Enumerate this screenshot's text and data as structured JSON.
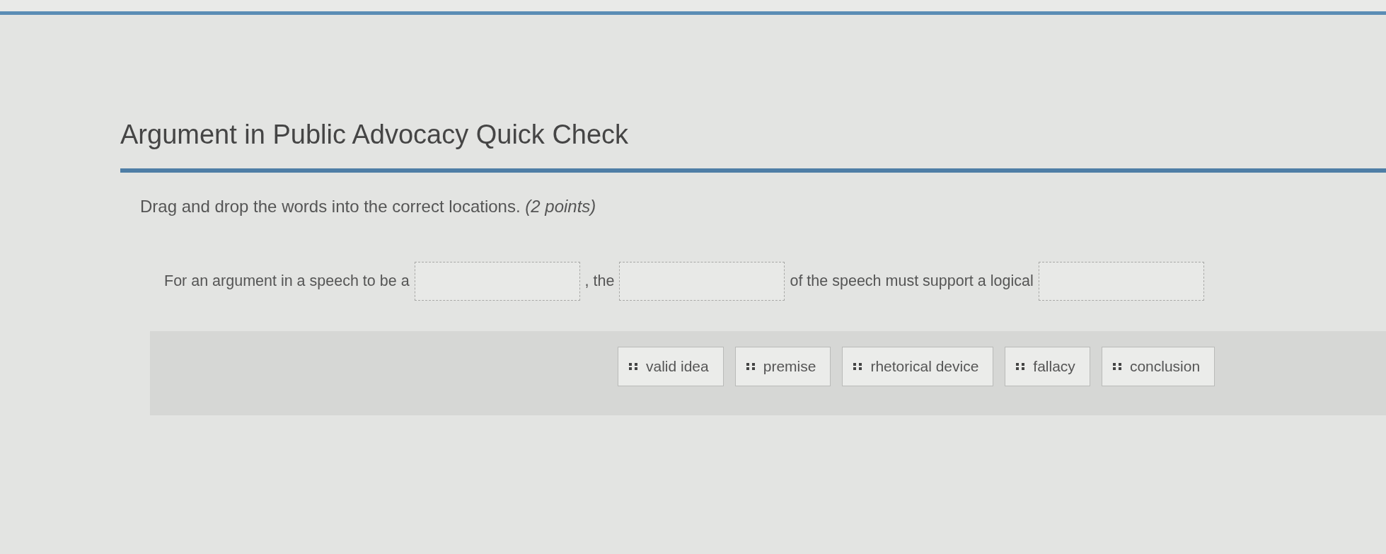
{
  "title": "Argument in Public Advocacy Quick Check",
  "question": {
    "instruction": "Drag and drop the words into the correct locations. *(2 points)*",
    "sentence": [
      {
        "kind": "text",
        "text": "For an argument in a speech to be a"
      },
      {
        "kind": "blank"
      },
      {
        "kind": "text",
        "text": ", the"
      },
      {
        "kind": "blank"
      },
      {
        "kind": "text",
        "text": "of the speech must support a logical"
      },
      {
        "kind": "blank"
      }
    ]
  },
  "word_bank": [
    {
      "label": "valid idea"
    },
    {
      "label": "premise"
    },
    {
      "label": "rhetorical device"
    },
    {
      "label": "fallacy"
    },
    {
      "label": "conclusion"
    }
  ]
}
